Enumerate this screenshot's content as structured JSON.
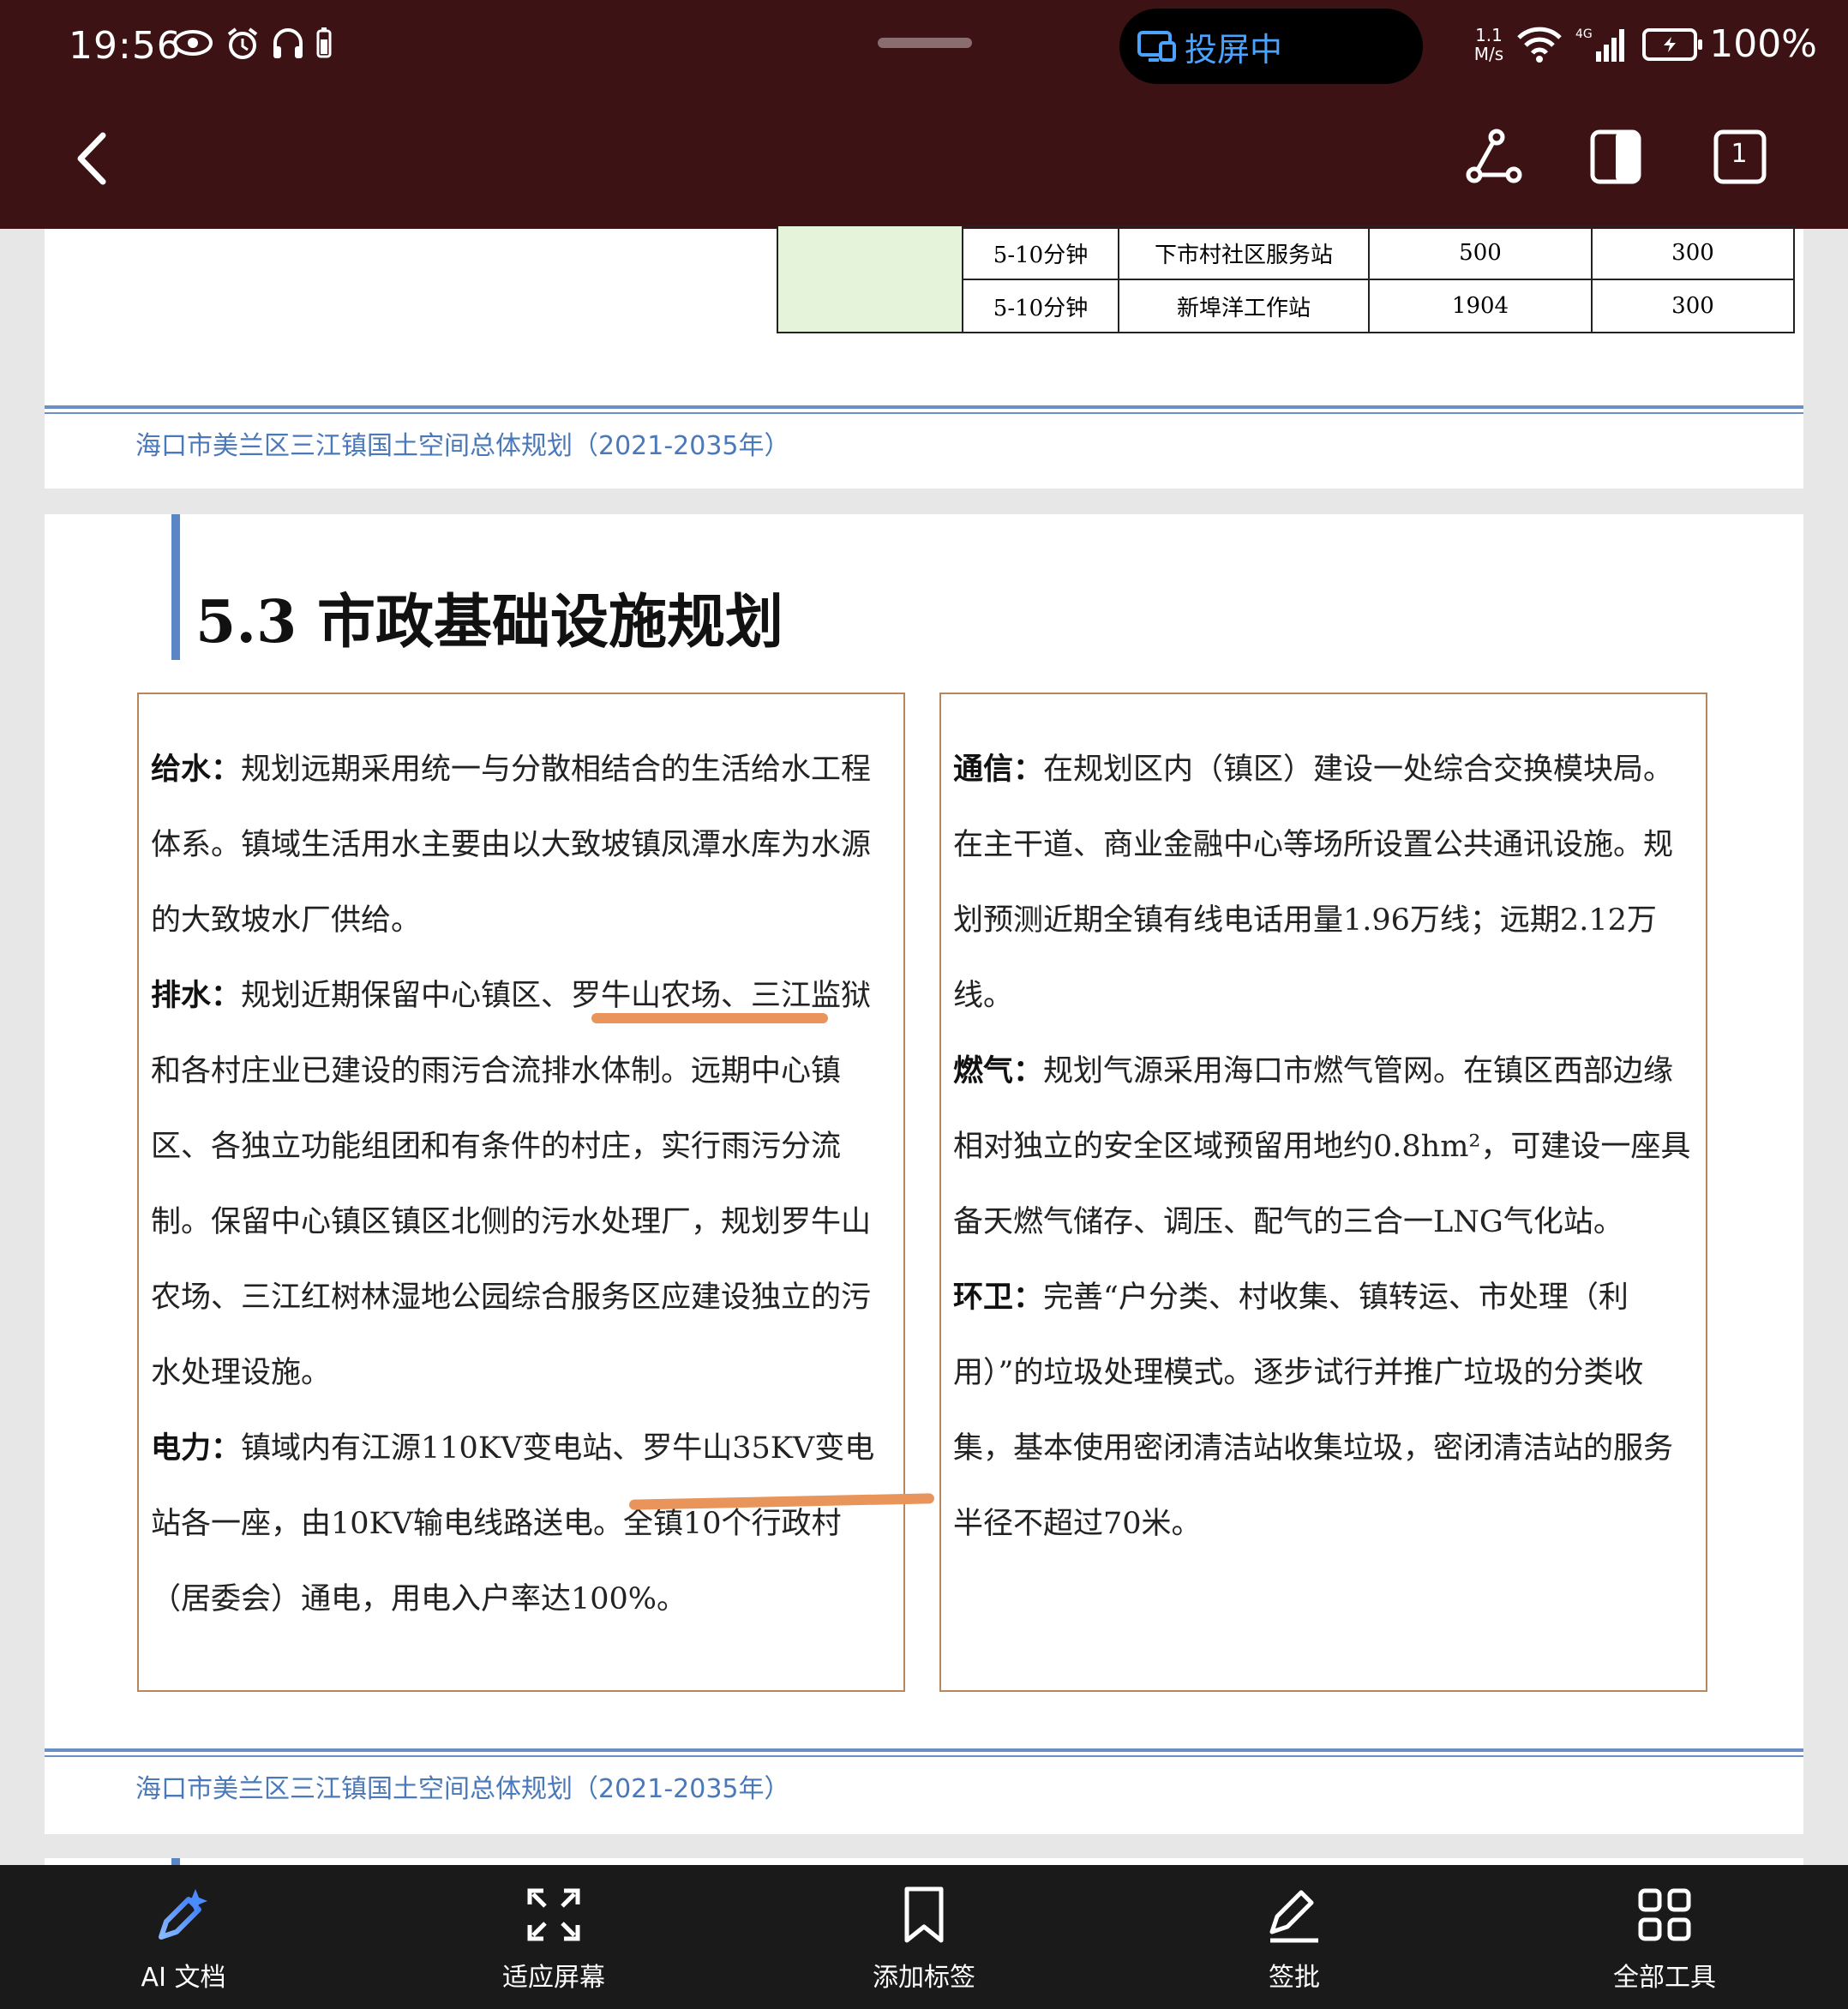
{
  "status_bar": {
    "time": "19:56",
    "casting_label": "投屏中",
    "net_speed_top": "1.1",
    "net_speed_bottom": "M/s",
    "battery": "100%"
  },
  "top_bar": {
    "page_count": "1"
  },
  "prev_page": {
    "table_rows": [
      {
        "time": "5-10分钟",
        "name": "下市村社区服务站",
        "area": "500",
        "size": "300"
      },
      {
        "time": "5-10分钟",
        "name": "新埠洋工作站",
        "area": "1904",
        "size": "300"
      }
    ],
    "footer": "海口市美兰区三江镇国土空间总体规划（2021-2035年）"
  },
  "current_page": {
    "heading": "5.3 市政基础设施规划",
    "left_box": {
      "water_supply_label": "给水：",
      "water_supply_text": "规划远期采用统一与分散相结合的生活给水工程体系。镇域生活用水主要由以大致坡镇凤潭水库为水源的大致坡水厂供给。",
      "drainage_label": "排水：",
      "drainage_text": "规划近期保留中心镇区、罗牛山农场、三江监狱和各村庄业已建设的雨污合流排水体制。远期中心镇区、各独立功能组团和有条件的村庄，实行雨污分流制。保留中心镇区镇区北侧的污水处理厂，规划罗牛山农场、三江红树林湿地公园综合服务区应建设独立的污水处理设施。",
      "power_label": "电力：",
      "power_text": "镇域内有江源110KV变电站、罗牛山35KV变电站各一座，由10KV输电线路送电。全镇10个行政村（居委会）通电，用电入户率达100%。"
    },
    "right_box": {
      "telecom_label": "通信：",
      "telecom_text": "在规划区内（镇区）建设一处综合交换模块局。在主干道、商业金融中心等场所设置公共通讯设施。规划预测近期全镇有线电话用量1.96万线；远期2.12万线。",
      "gas_label": "燃气：",
      "gas_text": "规划气源采用海口市燃气管网。在镇区西部边缘相对独立的安全区域预留用地约0.8hm²，可建设一座具备天燃气储存、调压、配气的三合一LNG气化站。",
      "sanitation_label": "环卫：",
      "sanitation_text": "完善“户分类、村收集、镇转运、市处理（利用）”的垃圾处理模式。逐步试行并推广垃圾的分类收集，基本使用密闭清洁站收集垃圾，密闭清洁站的服务半径不超过70米。"
    },
    "footer": "海口市美兰区三江镇国土空间总体规划（2021-2035年）"
  },
  "bottom_bar": {
    "items": [
      {
        "label": "AI 文档",
        "icon": "ai-pen-icon"
      },
      {
        "label": "适应屏幕",
        "icon": "fit-screen-icon"
      },
      {
        "label": "添加标签",
        "icon": "bookmark-icon"
      },
      {
        "label": "签批",
        "icon": "sign-pen-icon"
      },
      {
        "label": "全部工具",
        "icon": "grid-tools-icon"
      }
    ]
  },
  "colors": {
    "top_bar_bg": "#3d1214",
    "accent_blue": "#5b86c5",
    "highlight_orange": "#e8945a",
    "table_green": "#e4f3da",
    "box_border": "#b8865a"
  }
}
